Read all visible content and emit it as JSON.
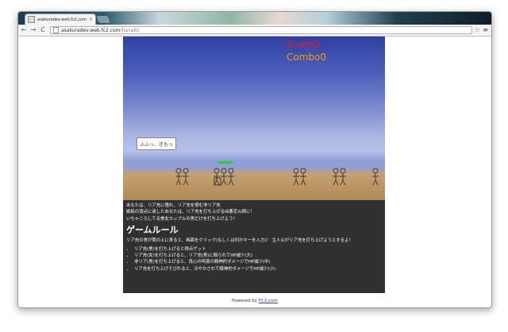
{
  "browser": {
    "tab_title": "asakuradev.web.fc2.com",
    "url_host": "asakuradev.web.fc2.com",
    "url_path": "/hanabi/",
    "back_glyph": "←",
    "forward_glyph": "→",
    "reload_glyph": "C",
    "star_glyph": "☆",
    "menu_glyph": "≡",
    "close_glyph": "×"
  },
  "game": {
    "score": "Score0",
    "combo": "Combo0",
    "speech": "ふふっ、ぎもっ",
    "score_color": "#e02020",
    "combo_color": "#f0a000",
    "hp_color": "#28d428"
  },
  "description": {
    "intro": [
      "あなたは、リア充に憧れ、リア充を憎む非リア充",
      "嫉妬の頂点に達したあなたは、リア充を打ち上げる凶悪花火師に！",
      "いちゃこらしてる美女カップルの男だけを打ち上げよう！"
    ],
    "rules_heading": "ゲームルール",
    "rules_text": "リア充の男が筒の上に来ると、画面をクリック(もしくは何かキーを入力)！ 主人公がリア充を打ち上げようとするよ！",
    "rules": [
      "リア充(男)を打ち上げると得点ゲット",
      "リア充(女)を打ち上げると、リア充(男)に殴られてHP減少(大)",
      "非リア(男)を打ち上げると、良心の呵責の精神的ダメージでHP減少(中)",
      "リア充を打ち上げそびれると、冷やかされて精神的ダメージでHP減少(小)"
    ]
  },
  "footer": {
    "prefix": "Powered by ",
    "link": "FC2.com"
  }
}
